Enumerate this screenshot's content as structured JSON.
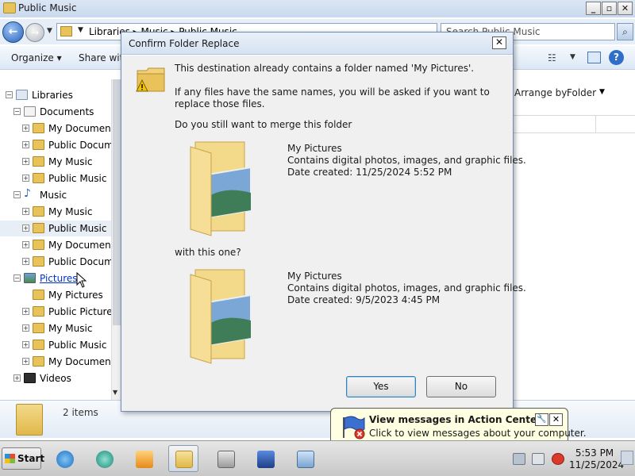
{
  "window": {
    "title": "Public Music",
    "address": "Libraries ▸ Music ▸ Public Music",
    "search_placeholder": "Search Public Music"
  },
  "toolbar": {
    "organize": "Organize ▾",
    "share": "Share with",
    "views_icon": "views-icon",
    "help": "?"
  },
  "nav": {
    "items": [
      {
        "label": "Libraries",
        "level": 0,
        "icon": "library-icon",
        "expander": "−"
      },
      {
        "label": "Documents",
        "level": 1,
        "icon": "documents-icon",
        "expander": "−"
      },
      {
        "label": "My Documents",
        "level": 2,
        "icon": "folder-icon",
        "expander": "+"
      },
      {
        "label": "Public Documents",
        "level": 2,
        "icon": "folder-icon",
        "expander": "+"
      },
      {
        "label": "My Music",
        "level": 2,
        "icon": "folder-icon",
        "expander": "+"
      },
      {
        "label": "Public Music",
        "level": 2,
        "icon": "folder-icon",
        "expander": "+"
      },
      {
        "label": "Music",
        "level": 1,
        "icon": "music-icon",
        "expander": "−"
      },
      {
        "label": "My Music",
        "level": 2,
        "icon": "folder-icon",
        "expander": "+"
      },
      {
        "label": "Public Music",
        "level": 2,
        "icon": "folder-icon",
        "expander": "+",
        "selected": true
      },
      {
        "label": "My Documents",
        "level": 2,
        "icon": "folder-icon",
        "expander": "+"
      },
      {
        "label": "Public Documents",
        "level": 2,
        "icon": "folder-icon",
        "expander": "+"
      },
      {
        "label": "Pictures",
        "level": 1,
        "icon": "pictures-icon",
        "expander": "−",
        "link": true
      },
      {
        "label": "My Pictures",
        "level": 2,
        "icon": "folder-icon",
        "expander": ""
      },
      {
        "label": "Public Pictures",
        "level": 2,
        "icon": "folder-icon",
        "expander": "+"
      },
      {
        "label": "My Music",
        "level": 2,
        "icon": "folder-icon",
        "expander": "+"
      },
      {
        "label": "Public Music",
        "level": 2,
        "icon": "folder-icon",
        "expander": "+"
      },
      {
        "label": "My Documents",
        "level": 2,
        "icon": "folder-icon",
        "expander": "+"
      },
      {
        "label": "Videos",
        "level": 1,
        "icon": "videos-icon",
        "expander": "+"
      }
    ]
  },
  "content": {
    "arrange_by_label": "Arrange by:",
    "arrange_by_value": "Folder"
  },
  "details": {
    "item_count": "2 items"
  },
  "dialog": {
    "title": "Confirm Folder Replace",
    "close": "✕",
    "line1": "This destination already contains a folder named 'My Pictures'.",
    "line2": "If any files have the same names, you will be asked if you want to replace those files.",
    "line3": "Do you still want to merge this folder",
    "with_this_one": "with this one?",
    "source": {
      "name": "My Pictures",
      "description": "Contains digital photos, images, and graphic files.",
      "date": "Date created: 11/25/2024 5:52 PM"
    },
    "destination": {
      "name": "My Pictures",
      "description": "Contains digital photos, images, and graphic files.",
      "date": "Date created: 9/5/2023 4:45 PM"
    },
    "yes": "Yes",
    "no": "No"
  },
  "balloon": {
    "title": "View messages in Action Center",
    "text": "Click to view messages about your computer.",
    "close": "✕",
    "settings": "🔧"
  },
  "taskbar": {
    "start": "Start",
    "time": "5:53 PM",
    "date": "11/25/2024"
  },
  "colors": {
    "accent": "#2a62b8",
    "balloon_bg": "#ffffe1",
    "dialog_bg": "#f0f0f0"
  }
}
